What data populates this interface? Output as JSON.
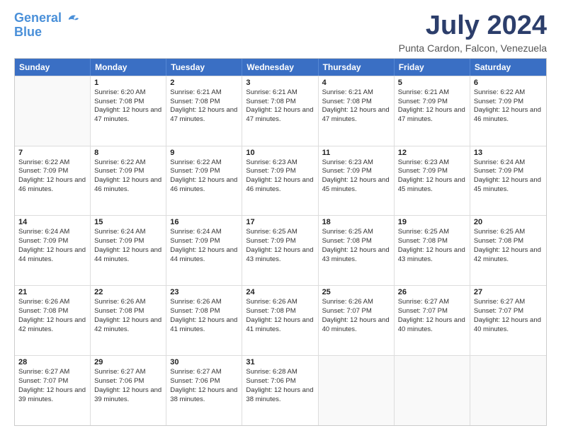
{
  "logo": {
    "line1": "General",
    "line2": "Blue"
  },
  "title": "July 2024",
  "location": "Punta Cardon, Falcon, Venezuela",
  "days": [
    "Sunday",
    "Monday",
    "Tuesday",
    "Wednesday",
    "Thursday",
    "Friday",
    "Saturday"
  ],
  "weeks": [
    [
      {
        "day": "",
        "sunrise": "",
        "sunset": "",
        "daylight": ""
      },
      {
        "day": "1",
        "sunrise": "6:20 AM",
        "sunset": "7:08 PM",
        "daylight": "12 hours and 47 minutes."
      },
      {
        "day": "2",
        "sunrise": "6:21 AM",
        "sunset": "7:08 PM",
        "daylight": "12 hours and 47 minutes."
      },
      {
        "day": "3",
        "sunrise": "6:21 AM",
        "sunset": "7:08 PM",
        "daylight": "12 hours and 47 minutes."
      },
      {
        "day": "4",
        "sunrise": "6:21 AM",
        "sunset": "7:08 PM",
        "daylight": "12 hours and 47 minutes."
      },
      {
        "day": "5",
        "sunrise": "6:21 AM",
        "sunset": "7:09 PM",
        "daylight": "12 hours and 47 minutes."
      },
      {
        "day": "6",
        "sunrise": "6:22 AM",
        "sunset": "7:09 PM",
        "daylight": "12 hours and 46 minutes."
      }
    ],
    [
      {
        "day": "7",
        "sunrise": "6:22 AM",
        "sunset": "7:09 PM",
        "daylight": "12 hours and 46 minutes."
      },
      {
        "day": "8",
        "sunrise": "6:22 AM",
        "sunset": "7:09 PM",
        "daylight": "12 hours and 46 minutes."
      },
      {
        "day": "9",
        "sunrise": "6:22 AM",
        "sunset": "7:09 PM",
        "daylight": "12 hours and 46 minutes."
      },
      {
        "day": "10",
        "sunrise": "6:23 AM",
        "sunset": "7:09 PM",
        "daylight": "12 hours and 46 minutes."
      },
      {
        "day": "11",
        "sunrise": "6:23 AM",
        "sunset": "7:09 PM",
        "daylight": "12 hours and 45 minutes."
      },
      {
        "day": "12",
        "sunrise": "6:23 AM",
        "sunset": "7:09 PM",
        "daylight": "12 hours and 45 minutes."
      },
      {
        "day": "13",
        "sunrise": "6:24 AM",
        "sunset": "7:09 PM",
        "daylight": "12 hours and 45 minutes."
      }
    ],
    [
      {
        "day": "14",
        "sunrise": "6:24 AM",
        "sunset": "7:09 PM",
        "daylight": "12 hours and 44 minutes."
      },
      {
        "day": "15",
        "sunrise": "6:24 AM",
        "sunset": "7:09 PM",
        "daylight": "12 hours and 44 minutes."
      },
      {
        "day": "16",
        "sunrise": "6:24 AM",
        "sunset": "7:09 PM",
        "daylight": "12 hours and 44 minutes."
      },
      {
        "day": "17",
        "sunrise": "6:25 AM",
        "sunset": "7:09 PM",
        "daylight": "12 hours and 43 minutes."
      },
      {
        "day": "18",
        "sunrise": "6:25 AM",
        "sunset": "7:08 PM",
        "daylight": "12 hours and 43 minutes."
      },
      {
        "day": "19",
        "sunrise": "6:25 AM",
        "sunset": "7:08 PM",
        "daylight": "12 hours and 43 minutes."
      },
      {
        "day": "20",
        "sunrise": "6:25 AM",
        "sunset": "7:08 PM",
        "daylight": "12 hours and 42 minutes."
      }
    ],
    [
      {
        "day": "21",
        "sunrise": "6:26 AM",
        "sunset": "7:08 PM",
        "daylight": "12 hours and 42 minutes."
      },
      {
        "day": "22",
        "sunrise": "6:26 AM",
        "sunset": "7:08 PM",
        "daylight": "12 hours and 42 minutes."
      },
      {
        "day": "23",
        "sunrise": "6:26 AM",
        "sunset": "7:08 PM",
        "daylight": "12 hours and 41 minutes."
      },
      {
        "day": "24",
        "sunrise": "6:26 AM",
        "sunset": "7:08 PM",
        "daylight": "12 hours and 41 minutes."
      },
      {
        "day": "25",
        "sunrise": "6:26 AM",
        "sunset": "7:07 PM",
        "daylight": "12 hours and 40 minutes."
      },
      {
        "day": "26",
        "sunrise": "6:27 AM",
        "sunset": "7:07 PM",
        "daylight": "12 hours and 40 minutes."
      },
      {
        "day": "27",
        "sunrise": "6:27 AM",
        "sunset": "7:07 PM",
        "daylight": "12 hours and 40 minutes."
      }
    ],
    [
      {
        "day": "28",
        "sunrise": "6:27 AM",
        "sunset": "7:07 PM",
        "daylight": "12 hours and 39 minutes."
      },
      {
        "day": "29",
        "sunrise": "6:27 AM",
        "sunset": "7:06 PM",
        "daylight": "12 hours and 39 minutes."
      },
      {
        "day": "30",
        "sunrise": "6:27 AM",
        "sunset": "7:06 PM",
        "daylight": "12 hours and 38 minutes."
      },
      {
        "day": "31",
        "sunrise": "6:28 AM",
        "sunset": "7:06 PM",
        "daylight": "12 hours and 38 minutes."
      },
      {
        "day": "",
        "sunrise": "",
        "sunset": "",
        "daylight": ""
      },
      {
        "day": "",
        "sunrise": "",
        "sunset": "",
        "daylight": ""
      },
      {
        "day": "",
        "sunrise": "",
        "sunset": "",
        "daylight": ""
      }
    ]
  ]
}
